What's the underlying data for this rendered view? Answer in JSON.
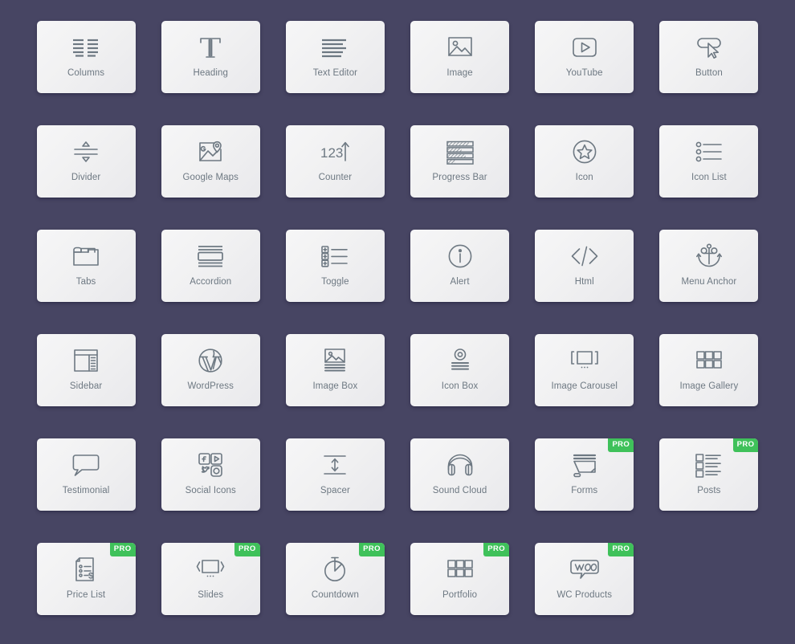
{
  "panel": {
    "background_color": "#474563",
    "card_color": "#f1f1f2",
    "icon_color": "#6d7882",
    "label_color": "#6d7882",
    "pro_badge_color": "#3fc15a",
    "pro_badge_text": "PRO",
    "columns": 6,
    "total_widgets": 35
  },
  "widgets": [
    {
      "label": "Columns",
      "icon": "columns-icon",
      "pro": false
    },
    {
      "label": "Heading",
      "icon": "heading-icon",
      "pro": false
    },
    {
      "label": "Text Editor",
      "icon": "text-editor-icon",
      "pro": false
    },
    {
      "label": "Image",
      "icon": "image-icon",
      "pro": false
    },
    {
      "label": "YouTube",
      "icon": "youtube-icon",
      "pro": false
    },
    {
      "label": "Button",
      "icon": "button-icon",
      "pro": false
    },
    {
      "label": "Divider",
      "icon": "divider-icon",
      "pro": false
    },
    {
      "label": "Google Maps",
      "icon": "google-maps-icon",
      "pro": false
    },
    {
      "label": "Counter",
      "icon": "counter-icon",
      "pro": false
    },
    {
      "label": "Progress Bar",
      "icon": "progress-bar-icon",
      "pro": false
    },
    {
      "label": "Icon",
      "icon": "star-circle-icon",
      "pro": false
    },
    {
      "label": "Icon List",
      "icon": "icon-list-icon",
      "pro": false
    },
    {
      "label": "Tabs",
      "icon": "tabs-icon",
      "pro": false
    },
    {
      "label": "Accordion",
      "icon": "accordion-icon",
      "pro": false
    },
    {
      "label": "Toggle",
      "icon": "toggle-icon",
      "pro": false
    },
    {
      "label": "Alert",
      "icon": "alert-info-icon",
      "pro": false
    },
    {
      "label": "Html",
      "icon": "code-icon",
      "pro": false
    },
    {
      "label": "Menu Anchor",
      "icon": "anchor-icon",
      "pro": false
    },
    {
      "label": "Sidebar",
      "icon": "sidebar-icon",
      "pro": false
    },
    {
      "label": "WordPress",
      "icon": "wordpress-icon",
      "pro": false
    },
    {
      "label": "Image Box",
      "icon": "image-box-icon",
      "pro": false
    },
    {
      "label": "Icon Box",
      "icon": "icon-box-icon",
      "pro": false
    },
    {
      "label": "Image Carousel",
      "icon": "image-carousel-icon",
      "pro": false
    },
    {
      "label": "Image Gallery",
      "icon": "image-gallery-icon",
      "pro": false
    },
    {
      "label": "Testimonial",
      "icon": "speech-bubble-icon",
      "pro": false
    },
    {
      "label": "Social Icons",
      "icon": "social-icons-icon",
      "pro": false
    },
    {
      "label": "Spacer",
      "icon": "spacer-icon",
      "pro": false
    },
    {
      "label": "Sound Cloud",
      "icon": "headphones-icon",
      "pro": false
    },
    {
      "label": "Forms",
      "icon": "forms-icon",
      "pro": true
    },
    {
      "label": "Posts",
      "icon": "posts-icon",
      "pro": true
    },
    {
      "label": "Price List",
      "icon": "price-list-icon",
      "pro": true
    },
    {
      "label": "Slides",
      "icon": "slides-icon",
      "pro": true
    },
    {
      "label": "Countdown",
      "icon": "stopwatch-icon",
      "pro": true
    },
    {
      "label": "Portfolio",
      "icon": "portfolio-grid-icon",
      "pro": true
    },
    {
      "label": "WC Products",
      "icon": "woocommerce-icon",
      "pro": true
    }
  ]
}
